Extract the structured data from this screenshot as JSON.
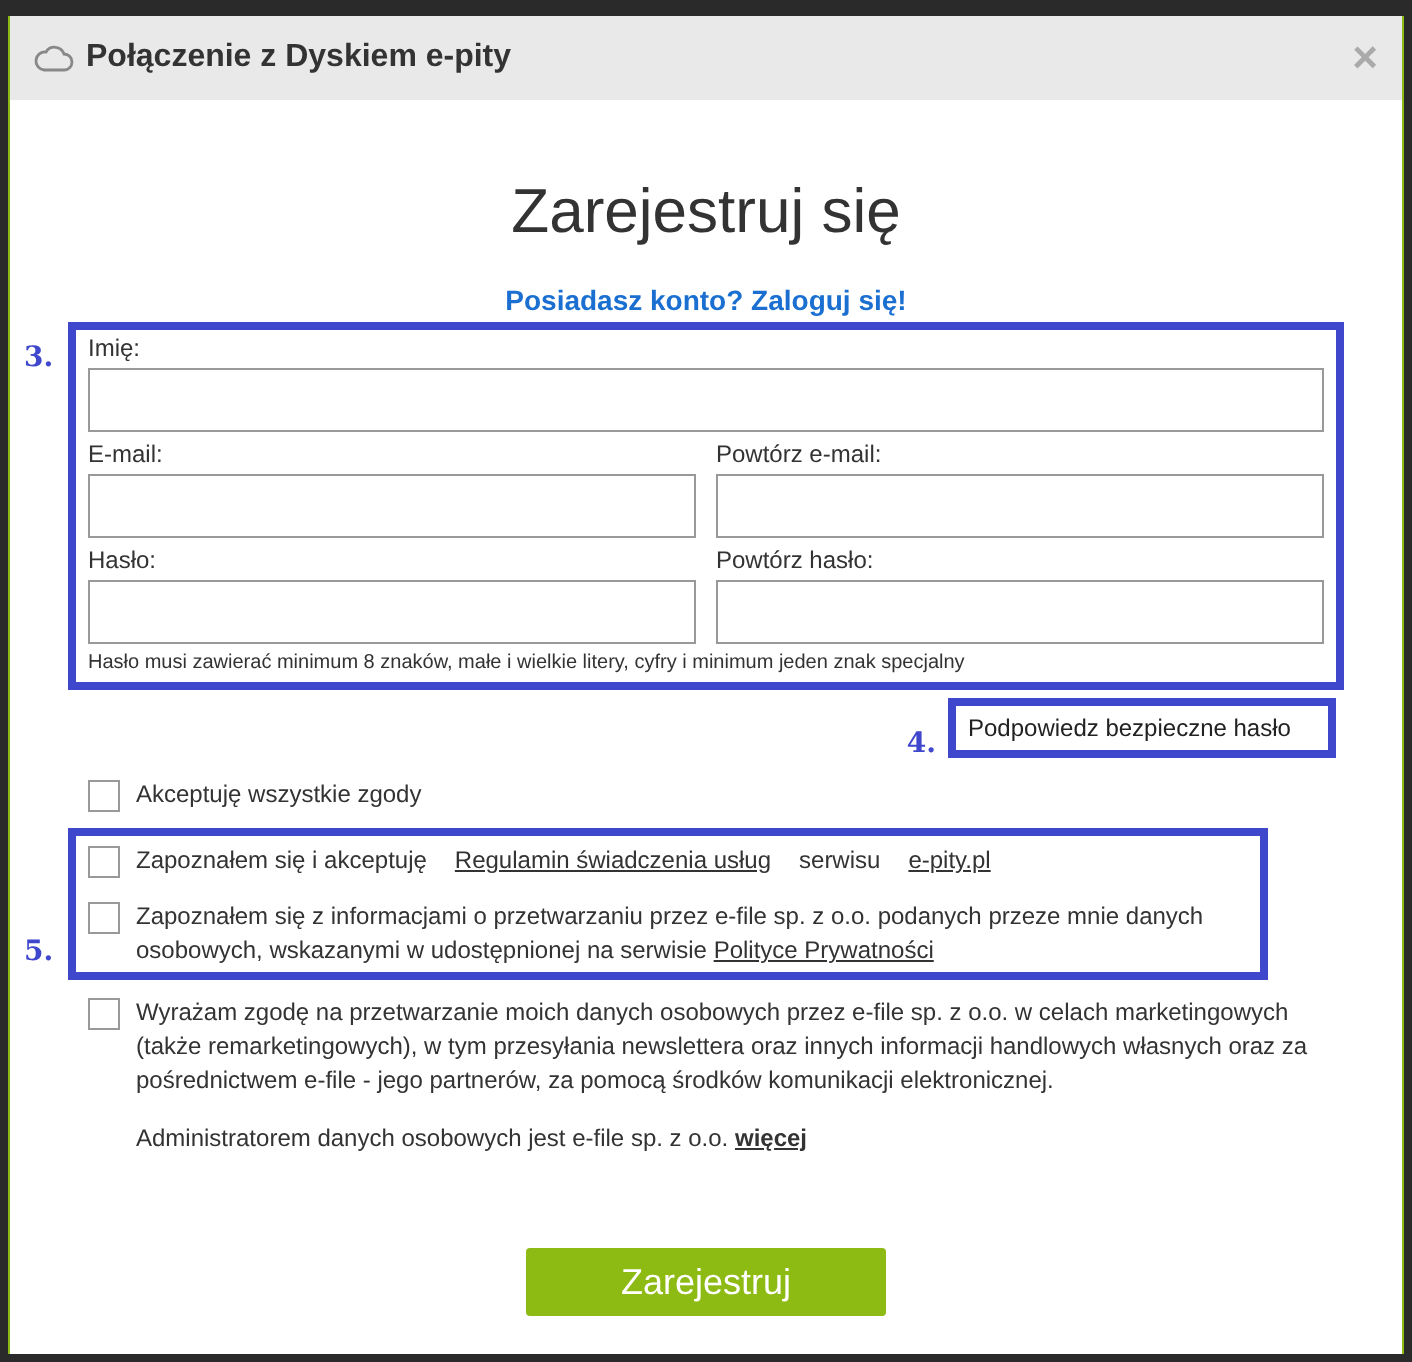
{
  "dialog": {
    "title": "Połączenie z Dyskiem e-pity",
    "close": "×"
  },
  "heading": "Zarejestruj się",
  "login_link": "Posiadasz konto? Zaloguj się!",
  "annotations": {
    "fields": "3.",
    "hint": "4.",
    "consents": "5."
  },
  "fields": [
    {
      "label": "Imię:",
      "kind": "full"
    },
    {
      "label": "E-mail:",
      "kind": "half"
    },
    {
      "label": "Powtórz e-mail:",
      "kind": "half"
    },
    {
      "label": "Hasło:",
      "kind": "half"
    },
    {
      "label": "Powtórz hasło:",
      "kind": "half"
    }
  ],
  "password_note": "Hasło musi zawierać minimum 8 znaków, małe i wielkie litery, cyfry i minimum jeden znak specjalny",
  "hint_button": "Podpowiedz bezpieczne hasło",
  "accept_all": {
    "label": "Akceptuję wszystkie zgody",
    "checked": false
  },
  "consents": [
    {
      "checked": false,
      "parts": [
        {
          "text": "Zapoznałem się i akceptuję",
          "link": false
        },
        {
          "text": "Regulamin świadczenia usług",
          "link": true
        },
        {
          "text": "serwisu",
          "link": false
        },
        {
          "text": "e-pity.pl",
          "link": true
        }
      ]
    },
    {
      "checked": false,
      "parts": [
        {
          "text": "Zapoznałem się z informacjami o przetwarzaniu przez e-file sp. z o.o. podanych przeze mnie danych osobowych, wskazanymi w udostępnionej na serwisie",
          "link": false
        },
        {
          "text": "Polityce Prywatności",
          "link": true
        }
      ]
    }
  ],
  "marketing": {
    "checked": false,
    "text": "Wyrażam zgodę na przetwarzanie moich danych osobowych przez e-file sp. z o.o. w celach marketingowych (także remarketingowych), w tym przesyłania newslettera oraz innych informacji handlowych własnych oraz za pośrednictwem e-file - jego partnerów, za pomocą środków komunikacji elektronicznej."
  },
  "admin_note": {
    "text": "Administratorem danych osobowych jest e-file sp. z o.o.",
    "link": "więcej"
  },
  "submit": "Zarejestruj"
}
